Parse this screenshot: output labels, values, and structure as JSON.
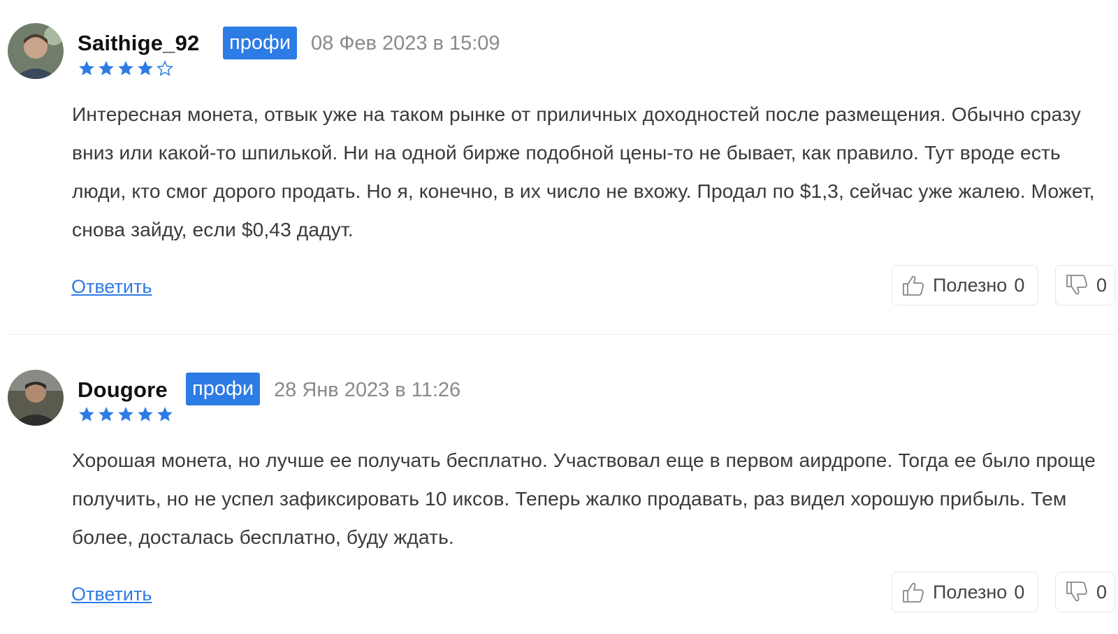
{
  "comments": [
    {
      "username": "Saithige_92",
      "badge": "профи",
      "date": "08 Фев 2023 в 15:09",
      "rating": 4,
      "rating_max": 5,
      "text": "Интересная монета, отвык уже на таком рынке от приличных доходностей после размещения. Обычно сразу вниз или какой-то шпилькой. Ни на одной бирже подобной цены-то не бывает, как правило. Тут вроде есть люди, кто смог дорого продать. Но я, конечно, в их число не вхожу. Продал по $1,3, сейчас уже жалею. Может, снова зайду, если $0,43 дадут.",
      "reply_label": "Ответить",
      "useful_label": "Полезно",
      "useful_count": "0",
      "dislike_count": "0",
      "icons": {
        "useful": "thumbs-up-icon",
        "dislike": "thumbs-down-icon"
      }
    },
    {
      "username": "Dougore",
      "badge": "профи",
      "date": "28 Янв 2023 в 11:26",
      "rating": 5,
      "rating_max": 5,
      "text": "Хорошая монета, но лучше ее получать бесплатно. Участвовал еще в первом аирдропе. Тогда ее было проще получить, но не успел зафиксировать 10 иксов. Теперь жалко продавать, раз видел хорошую прибыль. Тем более, досталась бесплатно, буду ждать.",
      "reply_label": "Ответить",
      "useful_label": "Полезно",
      "useful_count": "0",
      "dislike_count": "0",
      "icons": {
        "useful": "thumbs-up-icon",
        "dislike": "thumbs-down-icon"
      }
    }
  ],
  "colors": {
    "accent": "#2d7be5",
    "star": "#2d7be5",
    "muted": "#8a8a8a"
  }
}
